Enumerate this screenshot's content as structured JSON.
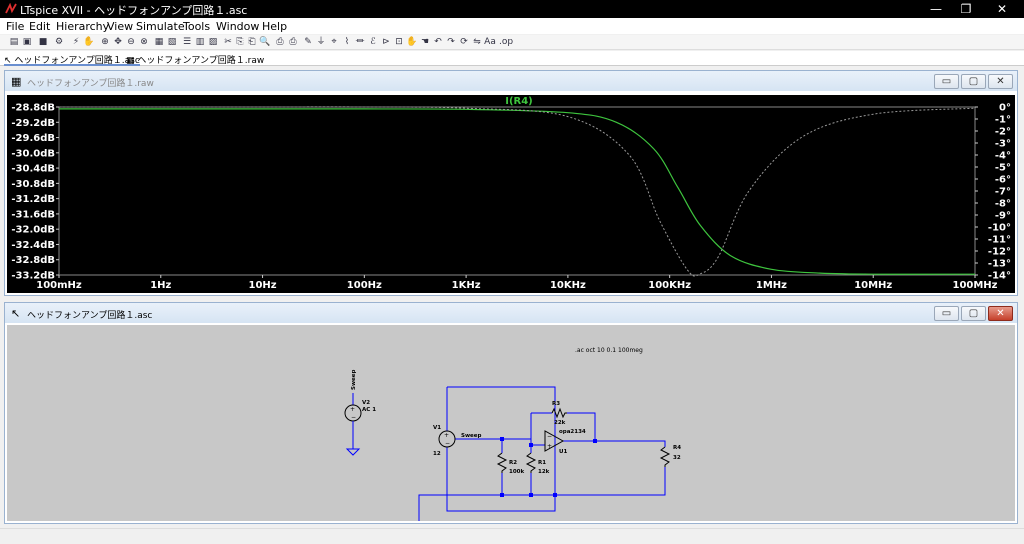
{
  "window": {
    "title": "LTspice XVII - ヘッドフォンアンプ回路１.asc",
    "minimize": "—",
    "restore": "❐",
    "close": "✕"
  },
  "menu": [
    "File",
    "Edit",
    "Hierarchy",
    "View",
    "Simulate",
    "Tools",
    "Window",
    "Help"
  ],
  "tabs": [
    {
      "label": "ヘッドフォンアンプ回路１.asc",
      "icon": "schematic-icon"
    },
    {
      "label": "ヘッドフォンアンプ回路１.raw",
      "icon": "waveform-icon"
    }
  ],
  "waveform_window": {
    "title": "ヘッドフォンアンプ回路１.raw",
    "btn_min": "▭",
    "btn_max": "▢",
    "btn_close": "✕"
  },
  "schematic_window": {
    "title": "ヘッドフォンアンプ回路１.asc",
    "btn_min": "▭",
    "btn_max": "▢",
    "btn_close": "✕"
  },
  "chart_data": {
    "type": "line",
    "title": "I(R4)",
    "x_scale": "log",
    "x_ticks": [
      "100mHz",
      "1Hz",
      "10Hz",
      "100Hz",
      "1KHz",
      "10KHz",
      "100KHz",
      "1MHz",
      "10MHz",
      "100MHz"
    ],
    "y_left_ticks": [
      "-28.8dB",
      "-29.2dB",
      "-29.6dB",
      "-30.0dB",
      "-30.4dB",
      "-30.8dB",
      "-31.2dB",
      "-31.6dB",
      "-32.0dB",
      "-32.4dB",
      "-32.8dB",
      "-33.2dB"
    ],
    "y_right_ticks": [
      "0°",
      "-1°",
      "-2°",
      "-3°",
      "-4°",
      "-5°",
      "-6°",
      "-7°",
      "-8°",
      "-9°",
      "-10°",
      "-11°",
      "-12°",
      "-13°",
      "-14°"
    ],
    "ylim_db": [
      -33.2,
      -28.8
    ],
    "ylim_phase_deg": [
      -14,
      0
    ],
    "series": [
      {
        "name": "I(R4)",
        "kind": "magnitude",
        "color": "#3ec43e",
        "x_hz": [
          0.1,
          1,
          10,
          100,
          1000,
          10000,
          30000,
          70000,
          120000,
          200000,
          400000,
          1000000,
          3000000,
          10000000,
          100000000
        ],
        "y_db": [
          -28.85,
          -28.85,
          -28.85,
          -28.85,
          -28.86,
          -28.95,
          -29.2,
          -29.9,
          -30.9,
          -31.9,
          -32.7,
          -33.05,
          -33.15,
          -33.18,
          -33.18
        ]
      },
      {
        "kind": "phase",
        "color": "#9a9a9a",
        "x_hz": [
          0.1,
          1,
          10,
          100,
          1000,
          10000,
          40000,
          80000,
          150000,
          200000,
          300000,
          600000,
          2000000,
          10000000,
          100000000
        ],
        "y_deg": [
          0,
          0,
          0,
          0,
          -0.1,
          -0.8,
          -4.0,
          -9.5,
          -13.6,
          -13.9,
          -12.5,
          -7.0,
          -2.5,
          -0.6,
          -0.1
        ]
      }
    ]
  },
  "schematic": {
    "directive": ".ac oct 10 0.1 100meg",
    "labels": {
      "sweep_label_top": "Sweep",
      "v2_name": "V2",
      "v2_value": "AC 1",
      "v1_name": "V1",
      "v1_value": "12",
      "sweep_net": "Sweep",
      "r3_name": "R3",
      "r3_value": "22k",
      "opamp_model": "opa2134",
      "u1_name": "U1",
      "r2_name": "R2",
      "r2_value": "100k",
      "r1_name": "R1",
      "r1_value": "12k",
      "r4_name": "R4",
      "r4_value": "32"
    }
  }
}
